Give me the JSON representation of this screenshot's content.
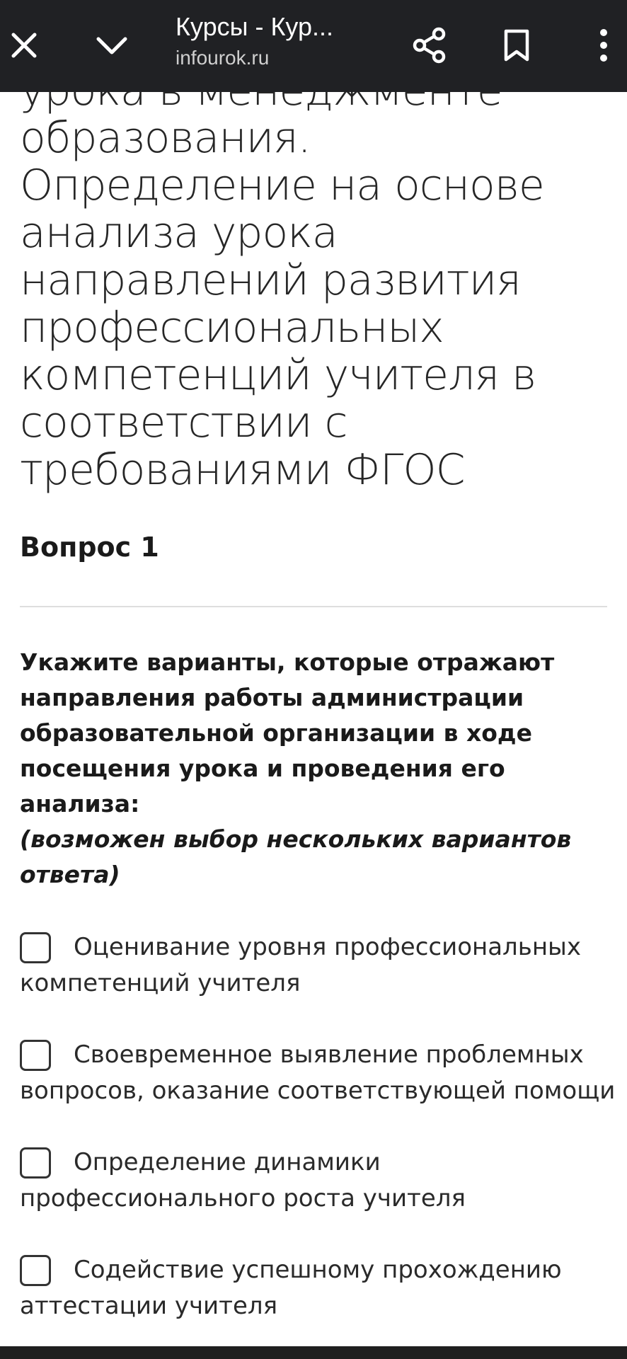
{
  "browser": {
    "tab_title": "Курсы - Кур...",
    "domain": "infourok.ru",
    "icons": [
      "close-icon",
      "chevron-down-icon",
      "share-icon",
      "bookmark-icon",
      "more-vert-icon"
    ]
  },
  "content": {
    "heading_lines": [
      "урока в менеджменте",
      "образования.",
      "Определение на основе",
      "анализа урока",
      "направлений развития",
      "профессиональных",
      "компетенций учителя в",
      "соответствии с",
      "требованиями ФГОС"
    ],
    "question_label": "Вопрос 1",
    "prompt_lines": [
      "Укажите варианты, которые отражают",
      "направления работы администрации",
      "образовательной организации в ходе",
      "посещения урока и проведения его",
      "анализа:"
    ],
    "prompt_note_lines": [
      "(возможен выбор нескольких вариантов",
      "ответа)"
    ],
    "options": [
      {
        "line1": "Оценивание уровня профессиональных",
        "line2": "компетенций учителя",
        "checked": false
      },
      {
        "line1": "Своевременное выявление проблемных",
        "line2": "вопросов, оказание соответствующей помощи",
        "checked": false
      },
      {
        "line1": "Определение динамики",
        "line2": "профессионального роста учителя",
        "checked": false
      },
      {
        "line1": "Содействие успешному прохождению",
        "line2": "аттестации учителя",
        "checked": false
      }
    ]
  },
  "colors": {
    "topbar_bg": "#202124",
    "text_primary": "#1a1a1a",
    "divider": "#dedede"
  }
}
